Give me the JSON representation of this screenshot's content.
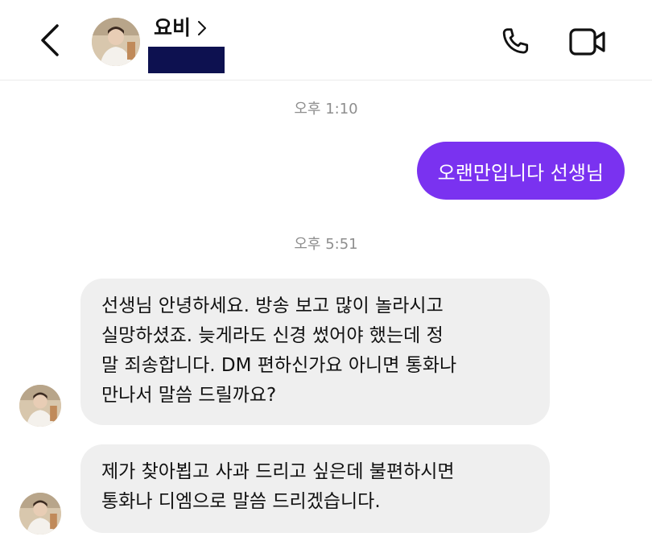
{
  "header": {
    "contact_name": "요비",
    "contact_chevron": ">",
    "icons": {
      "back": "chevron-left-icon",
      "call": "phone-icon",
      "video": "video-camera-icon"
    }
  },
  "conversation": {
    "timestamp_1": "오후 1:10",
    "outgoing_message": "오랜만입니다 선생님",
    "timestamp_2": "오후 5:51",
    "incoming_1": {
      "line_1": "선생님 안녕하세요. 방송 보고 많이 놀라시고",
      "line_2": "실망하셨죠. 늦게라도 신경 썼어야 했는데  정",
      "line_3": "말 죄송합니다. DM 편하신가요 아니면 통화나",
      "line_4": "만나서 말씀 드릴까요?"
    },
    "incoming_2": {
      "line_1": "제가 찾아뵙고 사과 드리고 싶은데 불편하시면",
      "line_2": "통화나 디엠으로 말씀 드리겠습니다."
    }
  },
  "colors": {
    "outgoing_bubble": "#7a32f0",
    "incoming_bubble": "#efefef",
    "redaction": "#0d1150",
    "timestamp_text": "#8e8e8e"
  }
}
